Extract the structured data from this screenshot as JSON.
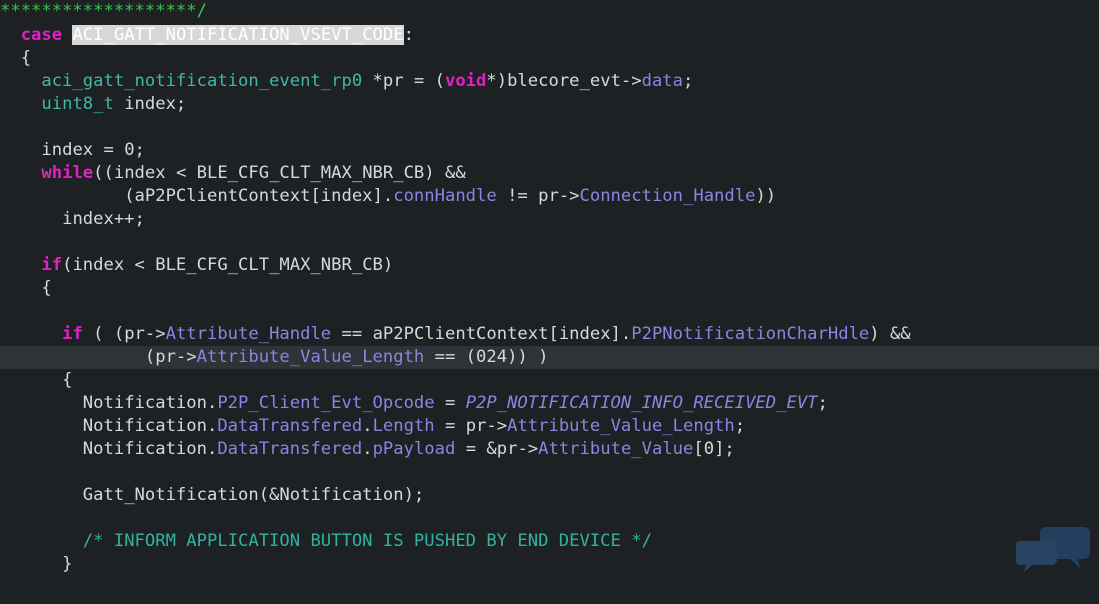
{
  "editor": {
    "lines": [
      {
        "indent": "",
        "segments": [
          {
            "t": "*******************/",
            "c": "gr"
          }
        ]
      },
      {
        "indent": "  ",
        "segments": [
          {
            "t": "case",
            "c": "kw"
          },
          {
            "t": " ",
            "c": ""
          },
          {
            "t": "ACI_GATT_NOTIFICATION_VSEVT_CODE",
            "c": "hl"
          },
          {
            "t": ":",
            "c": ""
          }
        ]
      },
      {
        "indent": "  ",
        "segments": [
          {
            "t": "{",
            "c": ""
          }
        ]
      },
      {
        "indent": "    ",
        "segments": [
          {
            "t": "aci_gatt_notification_event_rp0",
            "c": "ty"
          },
          {
            "t": " *pr = (",
            "c": ""
          },
          {
            "t": "void",
            "c": "kw"
          },
          {
            "t": "*)blecore_evt->",
            "c": ""
          },
          {
            "t": "data",
            "c": "mem"
          },
          {
            "t": ";",
            "c": ""
          }
        ]
      },
      {
        "indent": "    ",
        "segments": [
          {
            "t": "uint8_t",
            "c": "ty"
          },
          {
            "t": " index;",
            "c": ""
          }
        ]
      },
      {
        "indent": "",
        "segments": []
      },
      {
        "indent": "    ",
        "segments": [
          {
            "t": "index = 0;",
            "c": ""
          }
        ]
      },
      {
        "indent": "    ",
        "segments": [
          {
            "t": "while",
            "c": "kw"
          },
          {
            "t": "((index < BLE_CFG_CLT_MAX_NBR_CB) &&",
            "c": ""
          }
        ]
      },
      {
        "indent": "            ",
        "segments": [
          {
            "t": "(aP2PClientContext[index].",
            "c": ""
          },
          {
            "t": "connHandle",
            "c": "mem"
          },
          {
            "t": " != pr->",
            "c": ""
          },
          {
            "t": "Connection_Handle",
            "c": "mem"
          },
          {
            "t": "))",
            "c": ""
          }
        ]
      },
      {
        "indent": "      ",
        "segments": [
          {
            "t": "index++;",
            "c": ""
          }
        ]
      },
      {
        "indent": "",
        "segments": []
      },
      {
        "indent": "    ",
        "segments": [
          {
            "t": "if",
            "c": "kw"
          },
          {
            "t": "(index < BLE_CFG_CLT_MAX_NBR_CB)",
            "c": ""
          }
        ]
      },
      {
        "indent": "    ",
        "segments": [
          {
            "t": "{",
            "c": ""
          }
        ]
      },
      {
        "indent": "",
        "segments": []
      },
      {
        "indent": "      ",
        "segments": [
          {
            "t": "if",
            "c": "kw"
          },
          {
            "t": " ( (pr->",
            "c": ""
          },
          {
            "t": "Attribute_Handle",
            "c": "mem"
          },
          {
            "t": " == aP2PClientContext[index].",
            "c": ""
          },
          {
            "t": "P2PNotificationCharHdle",
            "c": "mem"
          },
          {
            "t": ") &&",
            "c": ""
          }
        ]
      },
      {
        "indent": "              ",
        "current": true,
        "segments": [
          {
            "t": "(pr->",
            "c": ""
          },
          {
            "t": "Attribute_Value_Length",
            "c": "mem"
          },
          {
            "t": " == (024)) )",
            "c": ""
          }
        ]
      },
      {
        "indent": "      ",
        "segments": [
          {
            "t": "{",
            "c": ""
          }
        ]
      },
      {
        "indent": "        ",
        "segments": [
          {
            "t": "Notification.",
            "c": ""
          },
          {
            "t": "P2P_Client_Evt_Opcode",
            "c": "mem"
          },
          {
            "t": " = ",
            "c": ""
          },
          {
            "t": "P2P_NOTIFICATION_INFO_RECEIVED_EVT",
            "c": "it"
          },
          {
            "t": ";",
            "c": ""
          }
        ]
      },
      {
        "indent": "        ",
        "segments": [
          {
            "t": "Notification.",
            "c": ""
          },
          {
            "t": "DataTransfered",
            "c": "mem"
          },
          {
            "t": ".",
            "c": ""
          },
          {
            "t": "Length",
            "c": "mem"
          },
          {
            "t": " = pr->",
            "c": ""
          },
          {
            "t": "Attribute_Value_Length",
            "c": "mem"
          },
          {
            "t": ";",
            "c": ""
          }
        ]
      },
      {
        "indent": "        ",
        "segments": [
          {
            "t": "Notification.",
            "c": ""
          },
          {
            "t": "DataTransfered",
            "c": "mem"
          },
          {
            "t": ".",
            "c": ""
          },
          {
            "t": "pPayload",
            "c": "mem"
          },
          {
            "t": " = &pr->",
            "c": ""
          },
          {
            "t": "Attribute_Value",
            "c": "mem"
          },
          {
            "t": "[0];",
            "c": ""
          }
        ]
      },
      {
        "indent": "",
        "segments": []
      },
      {
        "indent": "        ",
        "segments": [
          {
            "t": "Gatt_Notification(&Notification);",
            "c": ""
          }
        ]
      },
      {
        "indent": "",
        "segments": []
      },
      {
        "indent": "        ",
        "segments": [
          {
            "t": "/* INFORM APPLICATION BUTTON IS PUSHED BY END DEVICE */",
            "c": "cm"
          }
        ]
      },
      {
        "indent": "      ",
        "segments": [
          {
            "t": "}",
            "c": ""
          }
        ]
      }
    ]
  }
}
